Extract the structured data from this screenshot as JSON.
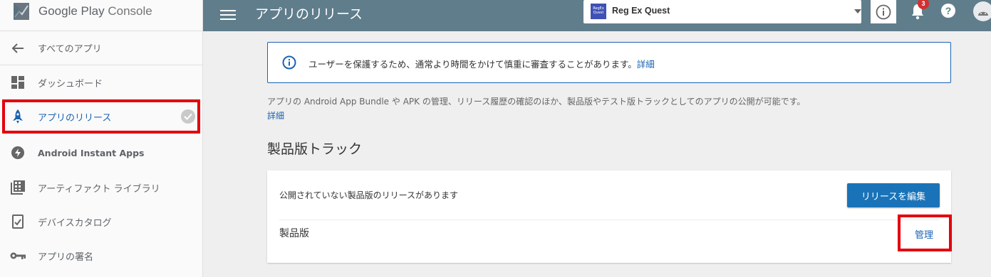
{
  "brand": {
    "google": "Google Play",
    "console": "Console"
  },
  "sidebar": {
    "back_label": "すべてのアプリ",
    "items": [
      {
        "label": "ダッシュボード",
        "icon": "dashboard-icon"
      },
      {
        "label": "アプリのリリース",
        "icon": "rocket-icon",
        "active": true
      },
      {
        "label": "Android Instant Apps",
        "icon": "lightning-icon"
      },
      {
        "label": "アーティファクト ライブラリ",
        "icon": "library-icon"
      },
      {
        "label": "デバイスカタログ",
        "icon": "device-icon"
      },
      {
        "label": "アプリの署名",
        "icon": "key-icon"
      }
    ]
  },
  "topbar": {
    "title": "アプリのリリース",
    "app_icon_text": "RegEx Quest",
    "app_name": "Reg Ex Quest",
    "notification_count": "3",
    "help_label": "?"
  },
  "notice": {
    "text": "ユーザーを保護するため、通常より時間をかけて慎重に審査することがあります。",
    "link": "詳細"
  },
  "description": {
    "text": "アプリの Android App Bundle や APK の管理、リリース履歴の確認のほか、製品版やテスト版トラックとしてのアプリの公開が可能です。",
    "link": "詳細"
  },
  "production": {
    "section_title": "製品版トラック",
    "unpublished_message": "公開されていない製品版のリリースがあります",
    "edit_button": "リリースを編集",
    "track_name": "製品版",
    "manage_link": "管理"
  },
  "colors": {
    "topbar": "#607d8b",
    "accent": "#1a63b3",
    "highlight": "#e4000f"
  }
}
